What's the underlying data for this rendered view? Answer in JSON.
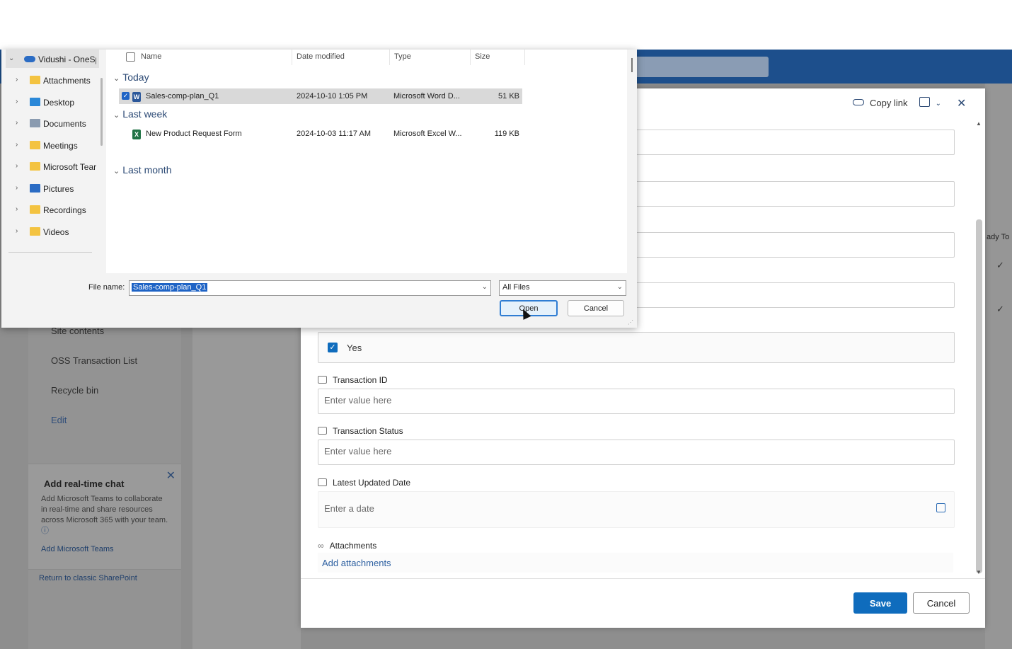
{
  "background": {
    "left_nav": [
      "Site contents",
      "OSS Transaction List",
      "Recycle bin"
    ],
    "edit_link": "Edit",
    "chat_card": {
      "title": "Add real-time chat",
      "description": "Add Microsoft Teams to collaborate in real-time and share resources across Microsoft 365 with your team.",
      "info_glyph": "ⓘ",
      "link": "Add Microsoft Teams",
      "close_glyph": "✕"
    },
    "return_classic": "Return to classic SharePoint",
    "right_column_header": "ady To",
    "check_glyph": "✓"
  },
  "form_panel": {
    "copy_link": "Copy link",
    "close_glyph": "✕",
    "checkbox_value": "Yes",
    "fields": [
      {
        "label": "Transaction ID",
        "placeholder": "Enter value here"
      },
      {
        "label": "Transaction Status",
        "placeholder": "Enter value here"
      },
      {
        "label": "Latest Updated Date",
        "placeholder": "Enter a date"
      }
    ],
    "attachments_label": "Attachments",
    "add_attachments": "Add attachments",
    "save": "Save",
    "cancel": "Cancel"
  },
  "file_dialog": {
    "root": "Vidushi - OneSp",
    "tree": [
      "Attachments",
      "Desktop",
      "Documents",
      "Meetings",
      "Microsoft Tear",
      "Pictures",
      "Recordings",
      "Videos"
    ],
    "tree_folder_colors": [
      "#f3c341",
      "#2b88d8",
      "#8a9bb0",
      "#f3c341",
      "#f3c341",
      "#2b6cc4",
      "#f3c341",
      "#f3c341"
    ],
    "columns": {
      "name": "Name",
      "date": "Date modified",
      "type": "Type",
      "size": "Size"
    },
    "groups": {
      "today": "Today",
      "last_week": "Last week",
      "last_month": "Last month"
    },
    "files": [
      {
        "name": "Sales-comp-plan_Q1",
        "date": "2024-10-10 1:05 PM",
        "type": "Microsoft Word D...",
        "size": "51 KB",
        "icon": "word-icon",
        "color": "#2b579a",
        "glyph": "W"
      },
      {
        "name": "New Product Request Form",
        "date": "2024-10-03 11:17 AM",
        "type": "Microsoft Excel W...",
        "size": "119 KB",
        "icon": "excel-icon",
        "color": "#217346",
        "glyph": "X"
      }
    ],
    "file_name_label": "File name:",
    "file_name_value": "Sales-comp-plan_Q1",
    "file_type": "All Files",
    "open": "Open",
    "cancel": "Cancel"
  }
}
